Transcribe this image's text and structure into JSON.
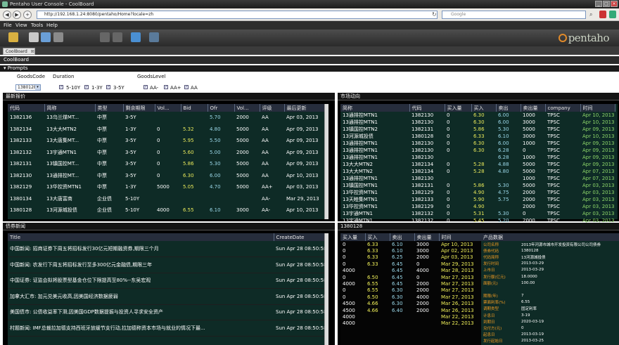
{
  "browser": {
    "title": "Pentaho User Console - CoolBoard",
    "url": "http://192.168.1.24:8080/pentaho/Home?locale=zh",
    "search_placeholder": "Google"
  },
  "menu": [
    "File",
    "View",
    "Tools",
    "Help"
  ],
  "tabs": [
    "CoolBoard"
  ],
  "dashboard_title": "CoolBoard",
  "prompts_label": "Prompts",
  "prompts": {
    "goods_code_label": "GoodsCode",
    "goods_code_value": "1380128",
    "duration_label": "Duration",
    "duration_options": [
      "5-10Y",
      "1-3Y",
      "3-5Y"
    ],
    "goods_level_label": "GoodsLevel",
    "goods_level_options": [
      "AA-",
      "AA+",
      "AA"
    ]
  },
  "left_top": {
    "title": "最新报价",
    "headers": [
      "代码",
      "简称",
      "类型",
      "剩余期限",
      "Vol...",
      "Bid",
      "Ofr",
      "Vol...",
      "评级",
      "最后更新"
    ],
    "rows": [
      [
        "1382136",
        "13乌兰煤MT...",
        "中票",
        "3-5Y",
        "",
        "",
        "5.70",
        "2000",
        "AA",
        "Apr 03, 2013"
      ],
      [
        "1382134",
        "13大大MTN2",
        "中票",
        "1-3Y",
        "0",
        "5.32",
        "4.80",
        "5000",
        "AA",
        "Apr 09, 2013"
      ],
      [
        "1382133",
        "13大唐集MT...",
        "中票",
        "3-5Y",
        "0",
        "5.95",
        "5.50",
        "5000",
        "AA",
        "Apr 09, 2013"
      ],
      [
        "1382132",
        "13宇通MTN1",
        "中票",
        "3-5Y",
        "0",
        "5.60",
        "5.00",
        "2000",
        "AA",
        "Apr 09, 2013"
      ],
      [
        "1382131",
        "13镇国控MT...",
        "中票",
        "3-5Y",
        "0",
        "5.86",
        "5.30",
        "5000",
        "AA",
        "Apr 09, 2013"
      ],
      [
        "1382130",
        "13通排控MT...",
        "中票",
        "3-5Y",
        "0",
        "6.30",
        "6.00",
        "5000",
        "AA",
        "Apr 10, 2013"
      ],
      [
        "1382129",
        "13华控资MTN1",
        "中票",
        "1-3Y",
        "5000",
        "5.05",
        "4.70",
        "5000",
        "AA+",
        "Apr 03, 2013"
      ],
      [
        "1380134",
        "13大唐富商",
        "企业债",
        "5-10Y",
        "",
        "",
        "",
        "",
        "AA-",
        "Mar 29, 2013"
      ],
      [
        "1380128",
        "13河源城投债",
        "企业债",
        "5-10Y",
        "4000",
        "6.55",
        "6.10",
        "3000",
        "AA-",
        "Apr 10, 2013"
      ]
    ]
  },
  "right_top": {
    "title": "市场动向",
    "headers": [
      "简称",
      "代码",
      "买入量",
      "买入",
      "卖出",
      "卖出量",
      "company",
      "时间"
    ],
    "rows": [
      [
        "13通排控MTN1",
        "1382130",
        "0",
        "6.30",
        "6.00",
        "1000",
        "TPSC",
        "Apr 10, 2013"
      ],
      [
        "13通排控MTN1",
        "1382130",
        "0",
        "6.30",
        "6.00",
        "3000",
        "TPSC",
        "Apr 10, 2013"
      ],
      [
        "13镇国控MTN2",
        "1382131",
        "0",
        "5.86",
        "5.30",
        "5000",
        "TPSC",
        "Apr 09, 2013"
      ],
      [
        "13河源城投债",
        "1380128",
        "0",
        "6.33",
        "6.10",
        "3000",
        "TPSC",
        "Apr 10, 2013"
      ],
      [
        "13通排控MTN1",
        "1382130",
        "0",
        "6.30",
        "6.00",
        "1000",
        "TPSC",
        "Apr 09, 2013"
      ],
      [
        "13通排控MTN1",
        "1382130",
        "0",
        "6.30",
        "6.28",
        "0",
        "TPSC",
        "Apr 09, 2013"
      ],
      [
        "13通排控MTN1",
        "1382130",
        "",
        "",
        "6.28",
        "1000",
        "TPSC",
        "Apr 09, 2013"
      ],
      [
        "13大大MTN2",
        "1382134",
        "0",
        "5.28",
        "4.88",
        "5000",
        "TPSC",
        "Apr 09, 2013"
      ],
      [
        "13大大MTN2",
        "1382134",
        "0",
        "5.28",
        "4.80",
        "5000",
        "TPSC",
        "Apr 07, 2013"
      ],
      [
        "13通排控MTN1",
        "1382130",
        "",
        "",
        "",
        "1000",
        "TPSC",
        "Apr 07, 2013"
      ],
      [
        "13镇国控MTN1",
        "1382131",
        "0",
        "5.86",
        "5.30",
        "5000",
        "TPSC",
        "Apr 03, 2013"
      ],
      [
        "13华控资MTN1",
        "1382129",
        "0",
        "4.90",
        "4.75",
        "2000",
        "TPSC",
        "Apr 03, 2013"
      ],
      [
        "13天睦集MTN1",
        "1382133",
        "0",
        "5.90",
        "5.75",
        "2000",
        "TPSC",
        "Apr 03, 2013"
      ],
      [
        "13华控资MTN1",
        "1382129",
        "0",
        "4.90",
        "",
        "2000",
        "TPSC",
        "Apr 03, 2013"
      ],
      [
        "13宇通MTN1",
        "1382132",
        "0",
        "5.31",
        "5.30",
        "0",
        "TPSC",
        "Apr 03, 2013"
      ],
      [
        "13宇通MTN1",
        "1382132",
        "0",
        "5.45",
        "5.20",
        "2000",
        "TPSC",
        "Apr 03, 2013"
      ],
      [
        "13宇通MTN1",
        "1382132",
        "0",
        "5.45",
        "5.30",
        "2000",
        "TPSC",
        "Apr 03, 2013"
      ]
    ]
  },
  "left_bottom": {
    "title": "债券新闻",
    "headers": [
      "Title",
      "CreateDate"
    ],
    "rows": [
      [
        "中国新闻: 招商证券下周五将招标发行30亿元短期融资券,期限三个月",
        "Sun Apr 28 08:50:58 CST 2013"
      ],
      [
        "中国新闻: 农发行下周五将招标发行至多300亿元金融债,期限三年",
        "Sun Apr 28 08:50:58 CST 2013"
      ],
      [
        "中国证券: 证监会拟将股票型基金仓位下限提高至80%--东吴宏观",
        "Sun Apr 28 08:50:58 CST 2013"
      ],
      [
        "加拿大汇市: 加元兑美元收高,因美国经济数据疲弱",
        "Sun Apr 28 08:50:58 CST 2013"
      ],
      [
        "美国债市: 公债收益率下滑,因美国GDP数据提振与投资人寻求安全资产",
        "Sun Apr 28 08:50:58 CST 2013"
      ],
      [
        "村题新闻: IMF总裁拉加德支持西班牙放缓节支行动,拉加德称资本市场与就业的情况下最...",
        "Sun Apr 28 08:50:58 CST 2013"
      ]
    ]
  },
  "right_bottom": {
    "title": "1380128",
    "headers": [
      "买入量",
      "买入",
      "卖出",
      "卖出量",
      "时间",
      "产品数据"
    ],
    "rows": [
      [
        "0",
        "6.33",
        "6.10",
        "3000",
        "Apr 10, 2013"
      ],
      [
        "0",
        "6.33",
        "6.10",
        "3000",
        "Apr 02, 2013"
      ],
      [
        "0",
        "6.33",
        "6.25",
        "2000",
        "Apr 03, 2013"
      ],
      [
        "0",
        "6.33",
        "6.45",
        "0",
        "Mar 29, 2013"
      ],
      [
        "4000",
        "",
        "6.45",
        "4000",
        "Mar 28, 2013"
      ],
      [
        "0",
        "6.50",
        "6.45",
        "0",
        "Mar 27, 2013"
      ],
      [
        "4000",
        "6.55",
        "6.45",
        "2000",
        "Mar 27, 2013"
      ],
      [
        "0",
        "6.55",
        "6.30",
        "2000",
        "Mar 27, 2013"
      ],
      [
        "0",
        "6.50",
        "6.30",
        "4000",
        "Mar 27, 2013"
      ],
      [
        "4500",
        "4.66",
        "6.30",
        "2000",
        "Mar 26, 2013"
      ],
      [
        "4500",
        "4.66",
        "6.40",
        "2000",
        "Mar 26, 2013"
      ],
      [
        "4000",
        "",
        "",
        "",
        "Mar 22, 2013"
      ],
      [
        "4000",
        "",
        "",
        "",
        "Mar 22, 2013"
      ]
    ],
    "product_info": [
      [
        "公司名称",
        "2013年河源市城市开发投资有限公司公司债券"
      ],
      [
        "债券代码",
        "1380128"
      ],
      [
        "代码简称",
        "13河源城投债"
      ],
      [
        "发行时间",
        "2013-03-29"
      ],
      [
        "上市日",
        "2013-03-29"
      ],
      [
        "发行额(亿元)",
        "18.0000"
      ],
      [
        "面额(元)",
        "100.00"
      ],
      [
        "",
        ""
      ],
      [
        "期限(年)",
        "7"
      ],
      [
        "票面利率(%)",
        "6.55"
      ],
      [
        "调期类型",
        "固定利率"
      ],
      [
        "计息日",
        "3-19"
      ],
      [
        "到期日",
        "2020-03-19"
      ],
      [
        "兑付方(元)",
        "0"
      ],
      [
        "起息日",
        "2013-03-19"
      ],
      [
        "发行起始日",
        "2013-03-25"
      ]
    ]
  }
}
